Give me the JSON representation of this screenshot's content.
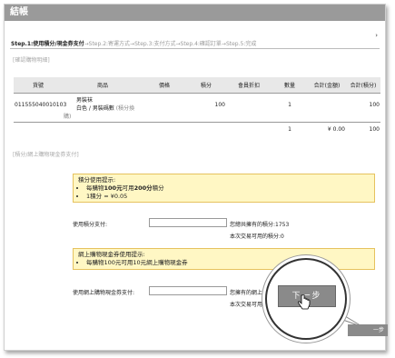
{
  "window": {
    "title": "結帳"
  },
  "steps": [
    "Step.1:使用積分/現金券支付",
    "→Step.2:寄運方式",
    "→Step.3:支付方式",
    "→Step.4:確認訂單",
    "→Step.5:完成"
  ],
  "sections": {
    "order_detail": "[確認購物明細]",
    "payment": "[積分/網上購物現金券支付]"
  },
  "table": {
    "headers": [
      "貨號",
      "商品",
      "價格",
      "積分",
      "會員折扣",
      "數量",
      "合計(金額)",
      "合計(積分)"
    ],
    "row": {
      "sku": "011555040010103",
      "product_line1": "男裝袜",
      "product_line2": "白色 / 男裝碼數",
      "product_note": "(積分換購)",
      "price": "",
      "points": "100",
      "discount": "",
      "qty": "1",
      "total_amount": "",
      "total_points": "100"
    },
    "total_row": {
      "qty": "1",
      "total_amount": "¥ 0.00",
      "total_points": "100"
    }
  },
  "points_notice": {
    "title": "積分使用提示:",
    "bullet1_pre": "每購物",
    "bullet1_b1": "100元",
    "bullet1_mid": "可用",
    "bullet1_b2": "200分",
    "bullet1_post": "積分",
    "bullet2": "1積分 = ¥0.05"
  },
  "points_field": {
    "label": "使用積分支付:",
    "value": "",
    "have": "您總共擁有的積分:1753",
    "usable": "本次交易可用的積分:0"
  },
  "voucher_notice": {
    "title": "網上購物現金券使用提示:",
    "bullet1": "每購物100元可用10元網上購物現金券"
  },
  "voucher_field": {
    "label": "使用網上購物現金券支付:",
    "value": "",
    "have": "您擁有的網上購",
    "usable": "本次交易可用"
  },
  "buttons": {
    "next_small": "一步",
    "next_big": "下一步"
  }
}
